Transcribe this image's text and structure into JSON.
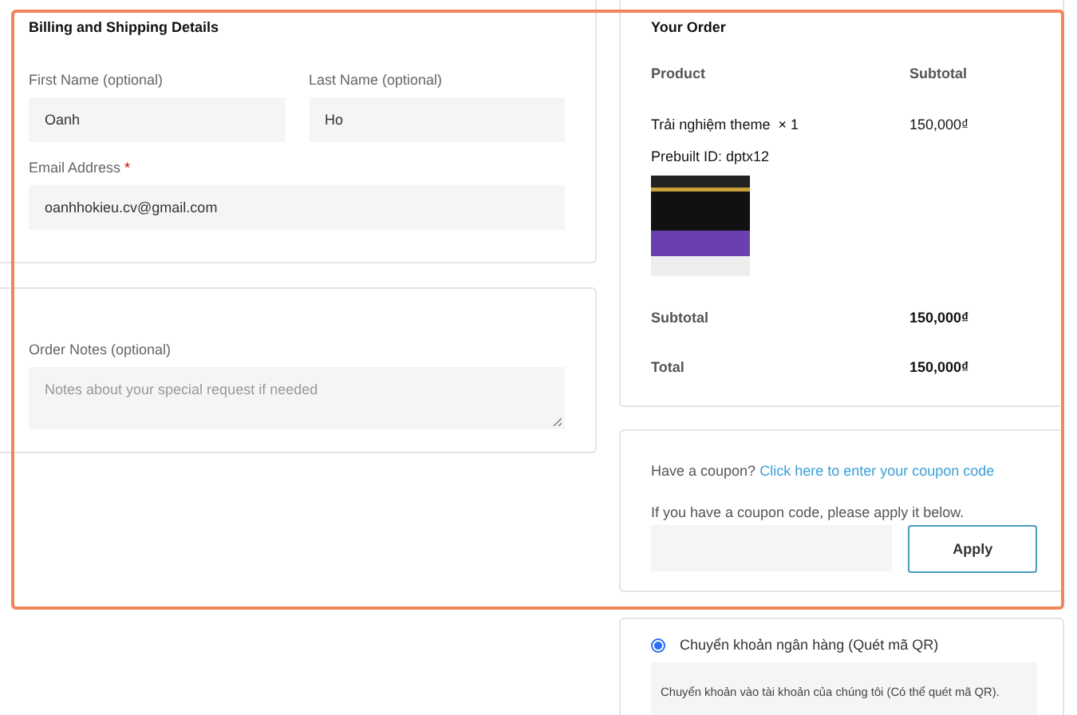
{
  "billing": {
    "title": "Billing and Shipping Details",
    "fields": [
      {
        "label": "First Name (optional)",
        "value": "Oanh"
      },
      {
        "label": "Last Name (optional)",
        "value": "Ho"
      },
      {
        "label": "Email Address",
        "value": "oanhhokieu.cv@gmail.com",
        "required_mark": "*"
      }
    ]
  },
  "notes": {
    "label": "Order Notes (optional)",
    "placeholder": "Notes about your special request if needed"
  },
  "order": {
    "title": "Your Order",
    "columns": [
      "Product",
      "Subtotal"
    ],
    "item": {
      "name": "Trải nghiệm theme",
      "quantity": "× 1",
      "price": "150,000₫",
      "meta": "Prebuilt ID: dptx12"
    },
    "totals": [
      {
        "label": "Subtotal",
        "value": "150,000₫"
      },
      {
        "label": "Total",
        "value": "150,000₫"
      }
    ]
  },
  "coupon": {
    "prompt": "Have a coupon?",
    "link": "Click here to enter your coupon code",
    "hint": "If you have a coupon code, please apply it below.",
    "button": "Apply"
  },
  "payment": {
    "methods": [
      {
        "label": "Chuyển khoản ngân hàng (Quét mã QR)",
        "selected": true,
        "description": "Chuyển khoản vào tài khoản của chúng tôi (Có thể quét mã QR)."
      }
    ]
  }
}
